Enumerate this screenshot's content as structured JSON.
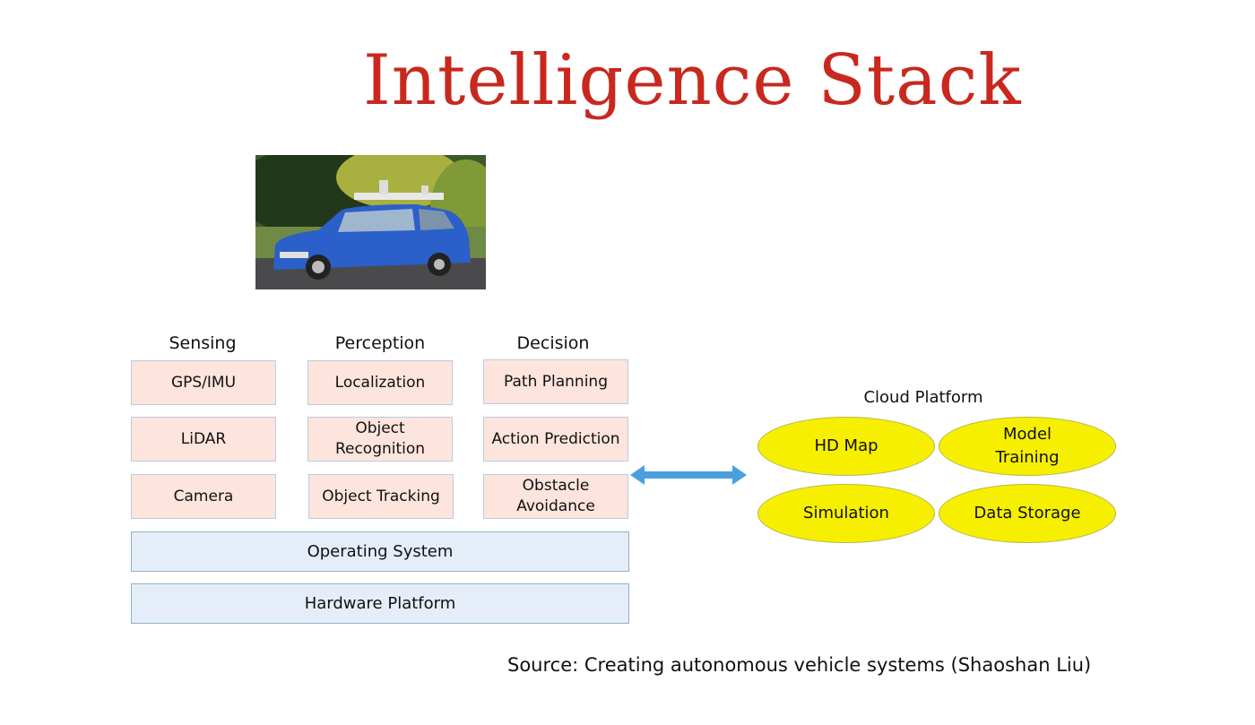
{
  "title": "Intelligence Stack",
  "photo": {
    "description": "blue autonomous research car with roof-mounted sensors",
    "icon": "car-photo"
  },
  "columns": [
    {
      "heading": "Sensing",
      "items": [
        "GPS/IMU",
        "LiDAR",
        "Camera"
      ]
    },
    {
      "heading": "Perception",
      "items": [
        "Localization",
        "Object Recognition",
        "Object Tracking"
      ]
    },
    {
      "heading": "Decision",
      "items": [
        "Path Planning",
        "Action Prediction",
        "Obstacle Avoidance"
      ]
    }
  ],
  "layers": [
    "Operating System",
    "Hardware Platform"
  ],
  "connector": {
    "type": "double-arrow",
    "color": "#4aa0de"
  },
  "cloud": {
    "title": "Cloud Platform",
    "items": [
      "HD Map",
      "Model Training",
      "Simulation",
      "Data Storage"
    ]
  },
  "source": "Source: Creating autonomous vehicle systems (Shaoshan Liu)",
  "colors": {
    "title": "#c8281e",
    "box_fill": "#fde4dc",
    "layer_fill": "#e5eef8",
    "ellipse_fill": "#f6ef00"
  }
}
